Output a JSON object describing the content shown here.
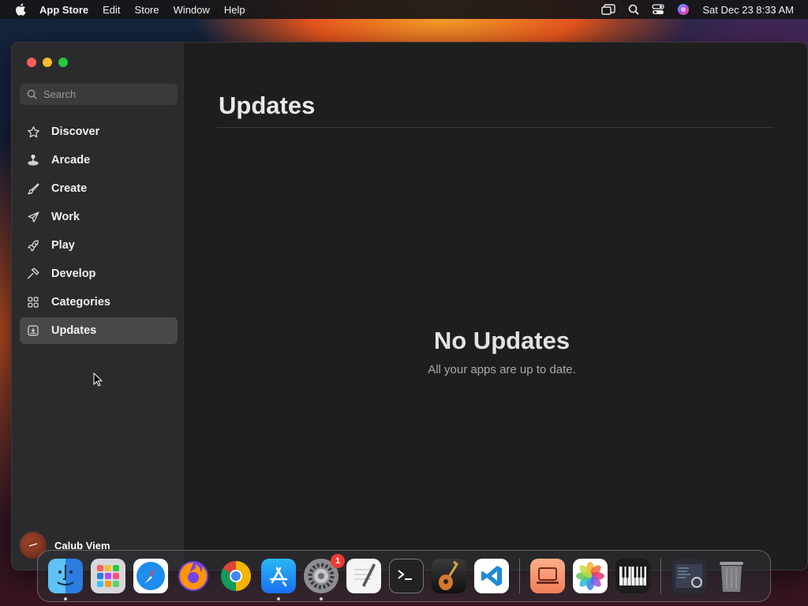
{
  "menubar": {
    "app_name": "App Store",
    "items": [
      "Edit",
      "Store",
      "Window",
      "Help"
    ],
    "datetime": "Sat Dec 23  8:33 AM"
  },
  "search": {
    "placeholder": "Search"
  },
  "sidebar": {
    "items": [
      {
        "label": "Discover",
        "icon": "star-icon"
      },
      {
        "label": "Arcade",
        "icon": "joystick-icon"
      },
      {
        "label": "Create",
        "icon": "brush-icon"
      },
      {
        "label": "Work",
        "icon": "paper-plane-icon"
      },
      {
        "label": "Play",
        "icon": "rocket-icon"
      },
      {
        "label": "Develop",
        "icon": "hammer-icon"
      },
      {
        "label": "Categories",
        "icon": "grid-icon"
      },
      {
        "label": "Updates",
        "icon": "download-tray-icon",
        "active": true
      }
    ],
    "user_name": "Calub Viem"
  },
  "main": {
    "title": "Updates",
    "empty_title": "No Updates",
    "empty_subtitle": "All your apps are up to date."
  },
  "dock": {
    "apps": [
      "Finder",
      "Launchpad",
      "Safari",
      "Firefox",
      "Chrome",
      "App Store",
      "System Settings",
      "TextEdit",
      "Terminal",
      "GarageBand",
      "VS Code",
      "Screen Sharing",
      "Photos",
      "Piano",
      "Activity Monitor",
      "Trash"
    ],
    "settings_badge": "1"
  },
  "colors": {
    "accent": "#48484b",
    "close": "#ff5f57",
    "minimize": "#febc2e",
    "zoom": "#28c840"
  }
}
